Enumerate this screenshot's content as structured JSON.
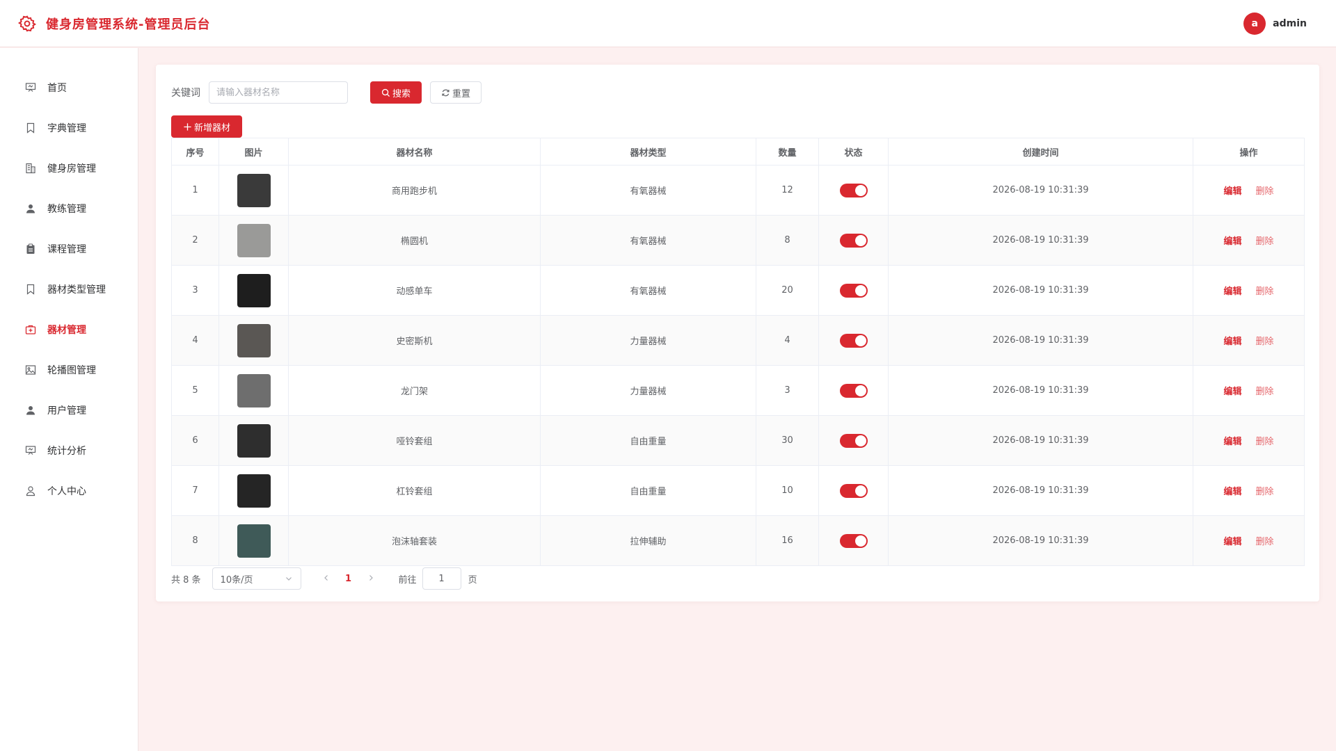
{
  "app": {
    "title": "健身房管理系统-管理员后台",
    "accent_color": "#d9282f"
  },
  "user": {
    "avatar_letter": "a",
    "name": "admin"
  },
  "sidebar": {
    "items": [
      {
        "label": "首页",
        "icon": "presentation-icon"
      },
      {
        "label": "字典管理",
        "icon": "bookmark-icon"
      },
      {
        "label": "健身房管理",
        "icon": "building-icon"
      },
      {
        "label": "教练管理",
        "icon": "user-solid-icon"
      },
      {
        "label": "课程管理",
        "icon": "clipboard-icon"
      },
      {
        "label": "器材类型管理",
        "icon": "bookmark-icon"
      },
      {
        "label": "器材管理",
        "icon": "first-aid-kit-icon",
        "active": true
      },
      {
        "label": "轮播图管理",
        "icon": "image-icon"
      },
      {
        "label": "用户管理",
        "icon": "user-solid-icon"
      },
      {
        "label": "统计分析",
        "icon": "presentation-icon"
      },
      {
        "label": "个人中心",
        "icon": "user-outline-icon"
      }
    ]
  },
  "filter": {
    "keyword_label": "关键词",
    "keyword_placeholder": "请输入器材名称",
    "keyword_value": "",
    "search_label": "搜索",
    "reset_label": "重置"
  },
  "toolbar": {
    "add_label": "新增器材"
  },
  "table": {
    "columns": [
      "序号",
      "图片",
      "器材名称",
      "器材类型",
      "数量",
      "状态",
      "创建时间",
      "操作"
    ],
    "edit_label": "编辑",
    "delete_label": "删除",
    "rows": [
      {
        "index": "1",
        "name": "商用跑步机",
        "type": "有氧器械",
        "quantity": "12",
        "status_on": true,
        "created": "2026-08-19 10:31:39",
        "thumb_color": "#3a3a3a"
      },
      {
        "index": "2",
        "name": "椭圆机",
        "type": "有氧器械",
        "quantity": "8",
        "status_on": true,
        "created": "2026-08-19 10:31:39",
        "thumb_color": "#9a9a98"
      },
      {
        "index": "3",
        "name": "动感单车",
        "type": "有氧器械",
        "quantity": "20",
        "status_on": true,
        "created": "2026-08-19 10:31:39",
        "thumb_color": "#1e1e1e"
      },
      {
        "index": "4",
        "name": "史密斯机",
        "type": "力量器械",
        "quantity": "4",
        "status_on": true,
        "created": "2026-08-19 10:31:39",
        "thumb_color": "#5a5754"
      },
      {
        "index": "5",
        "name": "龙门架",
        "type": "力量器械",
        "quantity": "3",
        "status_on": true,
        "created": "2026-08-19 10:31:39",
        "thumb_color": "#6e6e6e"
      },
      {
        "index": "6",
        "name": "哑铃套组",
        "type": "自由重量",
        "quantity": "30",
        "status_on": true,
        "created": "2026-08-19 10:31:39",
        "thumb_color": "#2e2e2e"
      },
      {
        "index": "7",
        "name": "杠铃套组",
        "type": "自由重量",
        "quantity": "10",
        "status_on": true,
        "created": "2026-08-19 10:31:39",
        "thumb_color": "#252525"
      },
      {
        "index": "8",
        "name": "泡沫轴套装",
        "type": "拉伸辅助",
        "quantity": "16",
        "status_on": true,
        "created": "2026-08-19 10:31:39",
        "thumb_color": "#3f5a58"
      }
    ]
  },
  "pagination": {
    "total_text": "共 8 条",
    "page_size": "10条/页",
    "current_page": "1",
    "goto_label": "前往",
    "goto_value": "1",
    "goto_suffix": "页"
  }
}
